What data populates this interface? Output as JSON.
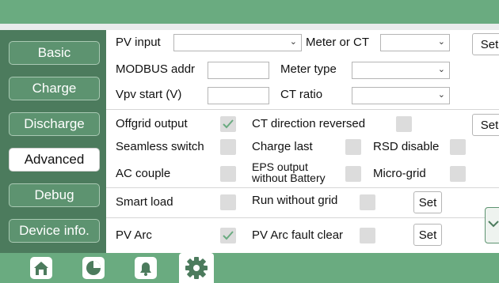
{
  "sidebar": {
    "items": [
      {
        "label": "Basic"
      },
      {
        "label": "Charge"
      },
      {
        "label": "Discharge"
      },
      {
        "label": "Advanced"
      },
      {
        "label": "Debug"
      },
      {
        "label": "Device info."
      }
    ],
    "active": "Advanced"
  },
  "settings": {
    "pv_input": {
      "label": "PV input",
      "value": ""
    },
    "meter_or_ct": {
      "label": "Meter or CT",
      "value": ""
    },
    "modbus_addr": {
      "label": "MODBUS addr",
      "value": ""
    },
    "meter_type": {
      "label": "Meter type",
      "value": ""
    },
    "vpv_start": {
      "label": "Vpv start (V)",
      "value": ""
    },
    "ct_ratio": {
      "label": "CT ratio",
      "value": ""
    },
    "offgrid_output": {
      "label": "Offgrid output",
      "checked": true
    },
    "ct_direction_reversed": {
      "label": "CT direction reversed",
      "checked": false
    },
    "seamless_switch": {
      "label": "Seamless switch",
      "checked": false
    },
    "charge_last": {
      "label": "Charge last",
      "checked": false
    },
    "rsd_disable": {
      "label": "RSD disable",
      "checked": false
    },
    "ac_couple": {
      "label": "AC couple",
      "checked": false
    },
    "eps_output_without_battery": {
      "label_line1": "EPS output",
      "label_line2": "without Battery",
      "checked": false
    },
    "micro_grid": {
      "label": "Micro-grid",
      "checked": false
    },
    "smart_load": {
      "label": "Smart load",
      "checked": false
    },
    "run_without_grid": {
      "label": "Run without grid",
      "checked": false
    },
    "pv_arc": {
      "label": "PV Arc",
      "checked": true
    },
    "pv_arc_fault_clear": {
      "label": "PV Arc fault clear",
      "checked": false
    }
  },
  "buttons": {
    "set_label": "Set",
    "set_top_label": "Set",
    "set_ct_label": "Set",
    "set_run_label": "Set",
    "set_arc_label": "Set"
  },
  "bottom_tabs": [
    {
      "icon": "home-icon"
    },
    {
      "icon": "pie-chart-icon"
    },
    {
      "icon": "bell-icon"
    },
    {
      "icon": "gear-icon"
    }
  ],
  "colors": {
    "header": "#6aab80",
    "sidebar": "#4c7b5d",
    "nav_button": "#5d9370",
    "check": "#6aab80"
  }
}
